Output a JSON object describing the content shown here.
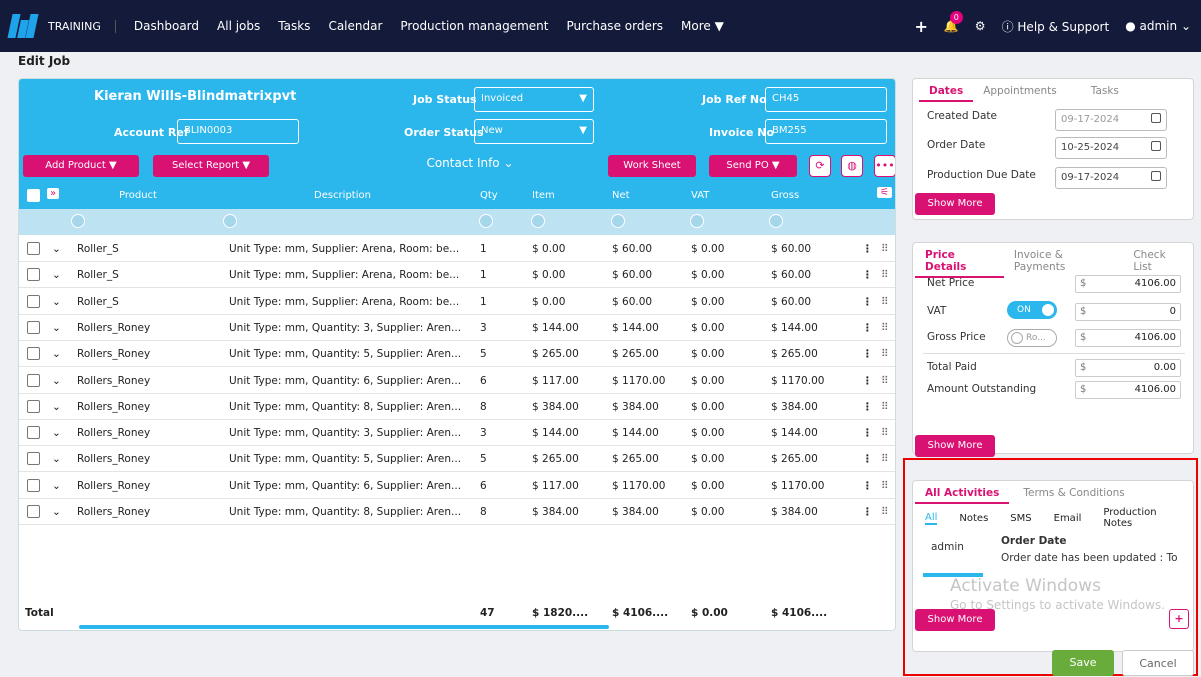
{
  "nav": {
    "brand": "TRAINING",
    "items": [
      "Dashboard",
      "All jobs",
      "Tasks",
      "Calendar",
      "Production management",
      "Purchase orders",
      "More"
    ],
    "notif_count": "0",
    "help": "Help & Support",
    "user": "admin"
  },
  "page_title": "Edit Job",
  "header": {
    "customer": "Kieran Wills-Blindmatrixpvt",
    "account_ref_label": "Account Ref",
    "account_ref": "BLIN0003",
    "job_status_label": "Job Status",
    "job_status": "Invoiced",
    "order_status_label": "Order Status",
    "order_status": "New",
    "job_ref_label": "Job Ref No",
    "job_ref": "CH45",
    "invoice_label": "Invoice No",
    "invoice_no": "BM255",
    "add_product": "Add Product",
    "select_report": "Select Report",
    "contact_info": "Contact Info",
    "work_sheet": "Work Sheet",
    "send_po": "Send PO"
  },
  "table": {
    "columns": [
      "Product",
      "Description",
      "Qty",
      "Item",
      "Net",
      "VAT",
      "Gross"
    ],
    "rows": [
      [
        "Roller_S",
        "Unit Type: mm, Supplier: Arena, Room: be...",
        "1",
        "$ 0.00",
        "$ 60.00",
        "$ 0.00",
        "$ 60.00"
      ],
      [
        "Roller_S",
        "Unit Type: mm, Supplier: Arena, Room: be...",
        "1",
        "$ 0.00",
        "$ 60.00",
        "$ 0.00",
        "$ 60.00"
      ],
      [
        "Roller_S",
        "Unit Type: mm, Supplier: Arena, Room: be...",
        "1",
        "$ 0.00",
        "$ 60.00",
        "$ 0.00",
        "$ 60.00"
      ],
      [
        "Rollers_Roney",
        "Unit Type: mm, Quantity: 3, Supplier: Aren...",
        "3",
        "$ 144.00",
        "$ 144.00",
        "$ 0.00",
        "$ 144.00"
      ],
      [
        "Rollers_Roney",
        "Unit Type: mm, Quantity: 5, Supplier: Aren...",
        "5",
        "$ 265.00",
        "$ 265.00",
        "$ 0.00",
        "$ 265.00"
      ],
      [
        "Rollers_Roney",
        "Unit Type: mm, Quantity: 6, Supplier: Aren...",
        "6",
        "$ 117.00",
        "$ 1170.00",
        "$ 0.00",
        "$ 1170.00"
      ],
      [
        "Rollers_Roney",
        "Unit Type: mm, Quantity: 8, Supplier: Aren...",
        "8",
        "$ 384.00",
        "$ 384.00",
        "$ 0.00",
        "$ 384.00"
      ],
      [
        "Rollers_Roney",
        "Unit Type: mm, Quantity: 3, Supplier: Aren...",
        "3",
        "$ 144.00",
        "$ 144.00",
        "$ 0.00",
        "$ 144.00"
      ],
      [
        "Rollers_Roney",
        "Unit Type: mm, Quantity: 5, Supplier: Aren...",
        "5",
        "$ 265.00",
        "$ 265.00",
        "$ 0.00",
        "$ 265.00"
      ],
      [
        "Rollers_Roney",
        "Unit Type: mm, Quantity: 6, Supplier: Aren...",
        "6",
        "$ 117.00",
        "$ 1170.00",
        "$ 0.00",
        "$ 1170.00"
      ],
      [
        "Rollers_Roney",
        "Unit Type: mm, Quantity: 8, Supplier: Aren...",
        "8",
        "$ 384.00",
        "$ 384.00",
        "$ 0.00",
        "$ 384.00"
      ]
    ],
    "total": {
      "label": "Total",
      "qty": "47",
      "item": "$ 1820....",
      "net": "$ 4106....",
      "vat": "$ 0.00",
      "gross": "$ 4106...."
    }
  },
  "dates": {
    "tabs": [
      "Dates",
      "Appointments",
      "Tasks"
    ],
    "created_label": "Created Date",
    "created": "09-17-2024",
    "order_label": "Order Date",
    "order": "10-25-2024",
    "due_label": "Production Due Date",
    "due": "09-17-2024",
    "show_more": "Show More"
  },
  "price": {
    "tabs": [
      "Price Details",
      "Invoice & Payments",
      "Check List"
    ],
    "net_label": "Net Price",
    "net": "4106.00",
    "vat_label": "VAT",
    "vat_toggle": "ON",
    "vat": "0",
    "gross_label": "Gross Price",
    "gross_toggle": "Ro...",
    "gross": "4106.00",
    "paid_label": "Total Paid",
    "paid": "0.00",
    "outstanding_label": "Amount Outstanding",
    "outstanding": "4106.00",
    "currency": "$",
    "show_more": "Show More"
  },
  "activities": {
    "tabs": [
      "All Activities",
      "Terms & Conditions"
    ],
    "subtabs": [
      "All",
      "Notes",
      "SMS",
      "Email",
      "Production Notes"
    ],
    "user": "admin",
    "title": "Order Date",
    "text": "Order date has been updated : To (",
    "show_more": "Show More"
  },
  "watermark": {
    "title": "Activate Windows",
    "sub": "Go to Settings to activate Windows."
  },
  "footer": {
    "save": "Save",
    "cancel": "Cancel"
  }
}
